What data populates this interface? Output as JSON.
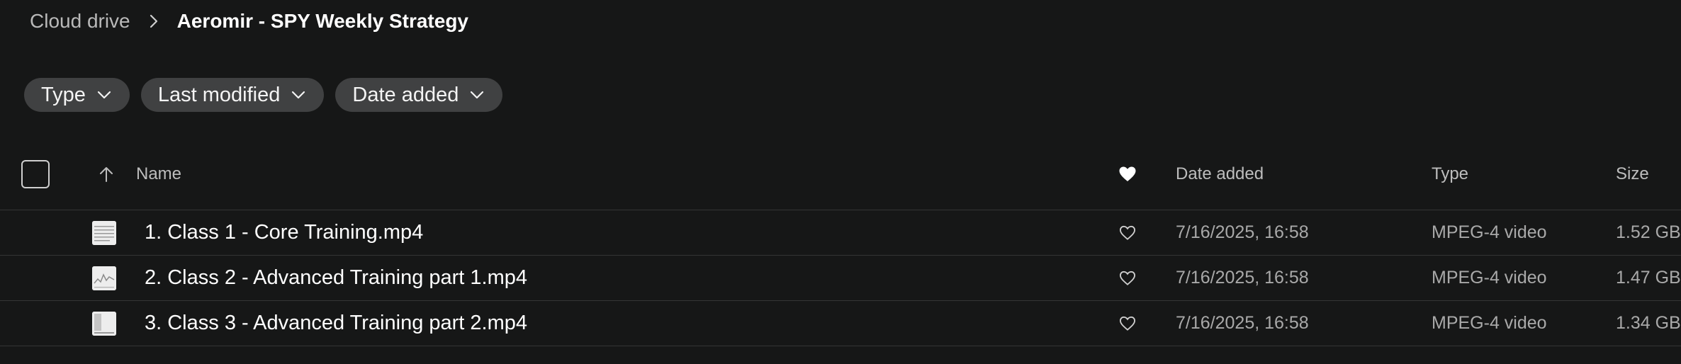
{
  "breadcrumb": {
    "parent": "Cloud drive",
    "current": "Aeromir - SPY Weekly Strategy"
  },
  "filters": [
    {
      "label": "Type"
    },
    {
      "label": "Last modified"
    },
    {
      "label": "Date added"
    }
  ],
  "table": {
    "columns": {
      "name": "Name",
      "date_added": "Date added",
      "type": "Type",
      "size": "Size"
    },
    "sort": {
      "column": "Name",
      "direction": "ascending"
    },
    "rows": [
      {
        "name": "1. Class 1 - Core Training.mp4",
        "date_added": "7/16/2025, 16:58",
        "type": "MPEG-4 video",
        "size": "1.52 GB",
        "favorite": false
      },
      {
        "name": "2. Class 2 - Advanced Training part 1.mp4",
        "date_added": "7/16/2025, 16:58",
        "type": "MPEG-4 video",
        "size": "1.47 GB",
        "favorite": false
      },
      {
        "name": "3. Class 3 - Advanced Training part 2.mp4",
        "date_added": "7/16/2025, 16:58",
        "type": "MPEG-4 video",
        "size": "1.34 GB",
        "favorite": false
      }
    ]
  },
  "icons": {
    "breadcrumb_separator": "chevron-right-icon",
    "filter_dropdown": "chevron-down-icon",
    "sort": "arrow-up-icon",
    "favorites_header": "heart-filled-icon",
    "row_favorite": "heart-outline-icon"
  },
  "colors": {
    "background": "#161717",
    "chip": "#404142",
    "divider": "#343535"
  }
}
